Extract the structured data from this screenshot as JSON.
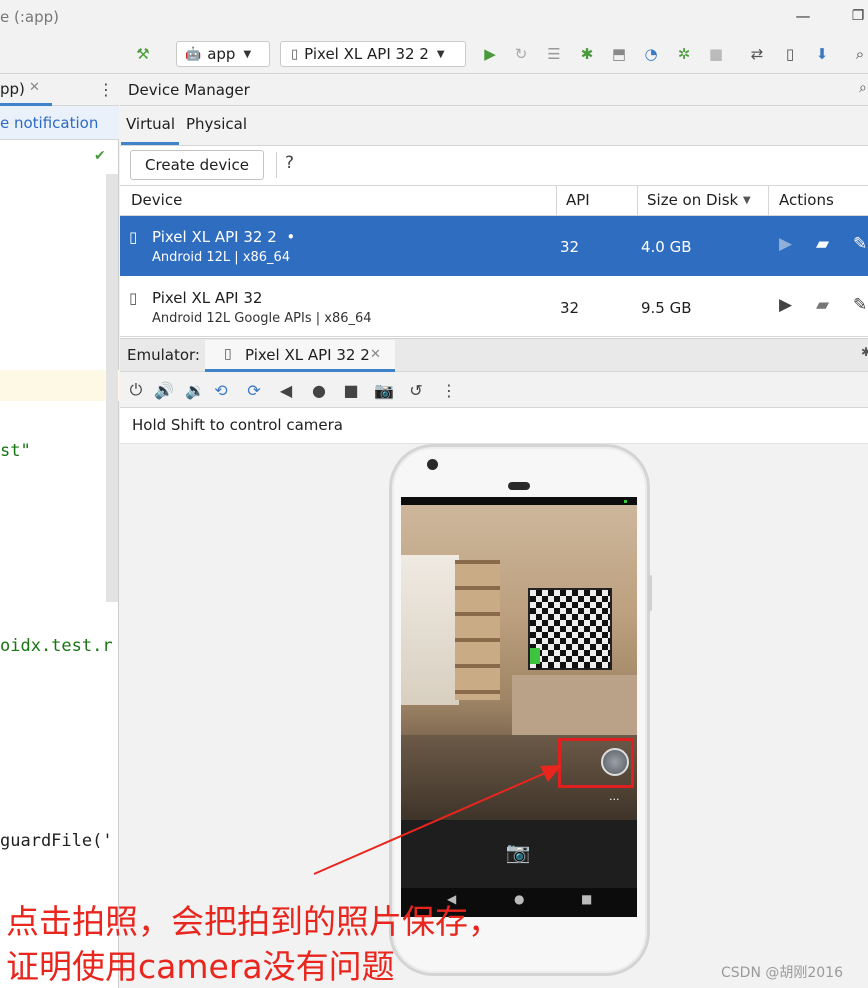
{
  "window": {
    "title": "e (:app)"
  },
  "toolbar": {
    "config": "app",
    "device": "Pixel XL API 32 2"
  },
  "editor": {
    "tab_label": "pp)",
    "banner": "e notification",
    "code_lines": [
      "st\"",
      "oidx.test.r",
      "guardFile('"
    ]
  },
  "device_manager": {
    "title": "Device Manager",
    "tabs": [
      "Virtual",
      "Physical"
    ],
    "create_button": "Create device",
    "help": "?",
    "columns": [
      "Device",
      "API",
      "Size on Disk",
      "Actions"
    ],
    "devices": [
      {
        "name": "Pixel XL API 32 2",
        "running_dot": "•",
        "sub": "Android 12L | x86_64",
        "api": "32",
        "size": "4.0 GB",
        "selected": true
      },
      {
        "name": "Pixel XL API 32",
        "running_dot": "",
        "sub": "Android 12L Google APIs | x86_64",
        "api": "32",
        "size": "9.5 GB",
        "selected": false
      }
    ]
  },
  "emulator": {
    "label": "Emulator:",
    "tab": "Pixel XL API 32 2",
    "hint": "Hold Shift to control camera",
    "thumb_more": "..."
  },
  "annotation": {
    "line1": "点击拍照，会把拍到的照片保存，",
    "line2": "证明使用camera没有问题",
    "color": "#e8261e"
  },
  "watermark": "CSDN @胡刚2016",
  "colors": {
    "accent": "#4083c9",
    "selected_row": "#2f6dc0",
    "run_green": "#4a9a3c"
  }
}
